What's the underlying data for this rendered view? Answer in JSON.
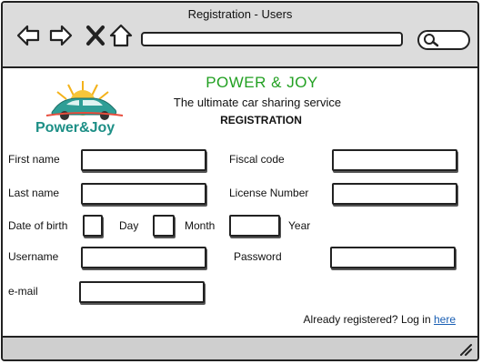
{
  "window": {
    "title": "Registration - Users"
  },
  "browser": {
    "back_icon": "back-arrow-icon",
    "forward_icon": "forward-arrow-icon",
    "stop_icon": "close-icon",
    "home_icon": "home-icon",
    "search_icon": "search-icon"
  },
  "header": {
    "logo_text": "Power&Joy",
    "brand": "POWER & JOY",
    "tagline": "The ultimate car sharing service",
    "section": "REGISTRATION"
  },
  "form": {
    "first_name": {
      "label": "First name",
      "value": ""
    },
    "fiscal_code": {
      "label": "Fiscal code",
      "value": ""
    },
    "last_name": {
      "label": "Last name",
      "value": ""
    },
    "license_number": {
      "label": "License Number",
      "value": ""
    },
    "date_of_birth": {
      "label": "Date of birth",
      "day_label": "Day",
      "month_label": "Month",
      "year_label": "Year"
    },
    "username": {
      "label": "Username",
      "value": ""
    },
    "password": {
      "label": "Password",
      "value": ""
    },
    "email": {
      "label": "e-mail",
      "value": ""
    }
  },
  "login": {
    "prompt": "Already registered? Log in ",
    "link": "here"
  },
  "colors": {
    "brand_green": "#22a022",
    "logo_teal": "#1d8f86",
    "link_blue": "#1a5fb4",
    "chrome_gray": "#dcdcdc"
  }
}
